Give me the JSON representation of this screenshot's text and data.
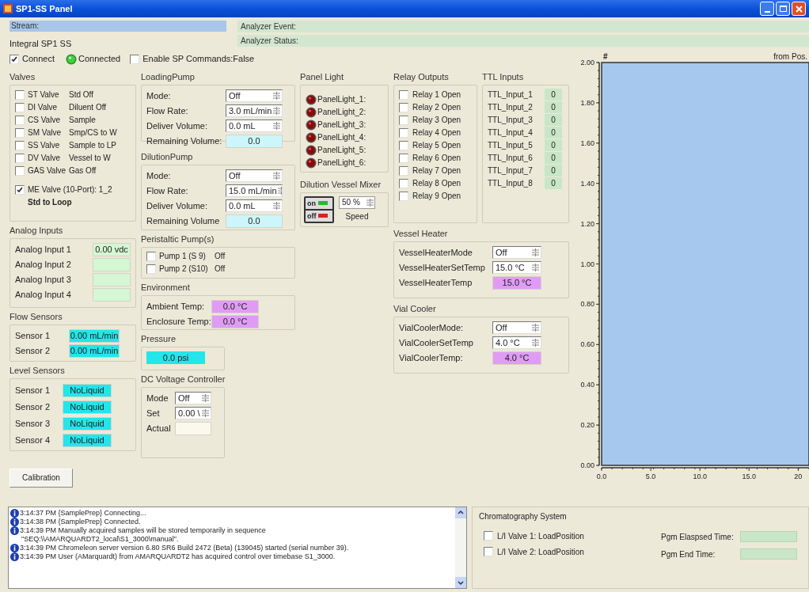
{
  "window": {
    "title": "SP1-SS Panel"
  },
  "header": {
    "stream_label": "Stream:",
    "analyzer_event_label": "Analyzer Event:",
    "analyzer_status_label": "Analyzer Status:",
    "device": "Integral SP1 SS"
  },
  "connection": {
    "connect": {
      "label": "Connect",
      "checked": true
    },
    "status": {
      "label": "Connected",
      "on": true
    },
    "enable_sp": {
      "label": "Enable SP Commands:False",
      "checked": false
    }
  },
  "valves": {
    "title": "Valves",
    "items": [
      {
        "name": "ST Valve",
        "state": "Std Off",
        "checked": false
      },
      {
        "name": "DI Valve",
        "state": "Diluent Off",
        "checked": false
      },
      {
        "name": "CS Valve",
        "state": "Sample",
        "checked": false
      },
      {
        "name": "SM Valve",
        "state": "Smp/CS to W",
        "checked": false
      },
      {
        "name": "SS Valve",
        "state": "Sample to LP",
        "checked": false
      },
      {
        "name": "DV Valve",
        "state": "Vessel to W",
        "checked": false
      },
      {
        "name": "GAS Valve",
        "state": "Gas Off",
        "checked": false
      }
    ],
    "me_valve": {
      "label": "ME Valve (10-Port): 1_2",
      "checked": true,
      "state": "Std to Loop"
    }
  },
  "loading_pump": {
    "title": "LoadingPump",
    "fields": [
      {
        "label": "Mode:",
        "kind": "spin",
        "value": "Off"
      },
      {
        "label": "Flow Rate:",
        "kind": "spin",
        "value": "3.0 mL/min"
      },
      {
        "label": "Deliver Volume:",
        "kind": "spin",
        "value": "0.0 mL"
      },
      {
        "label": "Remaining Volume:",
        "kind": "readout",
        "value": "0.0",
        "color": "#ccf6fb"
      }
    ]
  },
  "dilution_pump": {
    "title": "DilutionPump",
    "fields": [
      {
        "label": "Mode:",
        "kind": "spin",
        "value": "Off"
      },
      {
        "label": "Flow Rate:",
        "kind": "spin",
        "value": "15.0 mL/min"
      },
      {
        "label": "Deliver Volume:",
        "kind": "spin",
        "value": "0.0 mL"
      },
      {
        "label": "Remaining Volume",
        "kind": "readout",
        "value": "0.0",
        "color": "#ccf6fb"
      }
    ]
  },
  "panel_light": {
    "title": "Panel Light",
    "lights": [
      {
        "label": "PanelLight_1:"
      },
      {
        "label": "PanelLight_2:"
      },
      {
        "label": "PanelLight_3:"
      },
      {
        "label": "PanelLight_4:"
      },
      {
        "label": "PanelLight_5:"
      },
      {
        "label": "PanelLight_6:"
      }
    ]
  },
  "mixer": {
    "title": "Dilution Vessel Mixer",
    "on": true,
    "on_label": "on",
    "off_label": "off",
    "speed": "50 %",
    "speed_label": "Speed"
  },
  "relays": {
    "title": "Relay Outputs",
    "items": [
      {
        "label": "Relay 1 Open",
        "checked": false
      },
      {
        "label": "Relay 2 Open",
        "checked": false
      },
      {
        "label": "Relay 3 Open",
        "checked": false
      },
      {
        "label": "Relay 4 Open",
        "checked": false
      },
      {
        "label": "Relay 5 Open",
        "checked": false
      },
      {
        "label": "Relay 6 Open",
        "checked": false
      },
      {
        "label": "Relay 7 Open",
        "checked": false
      },
      {
        "label": "Relay 8 Open",
        "checked": false
      },
      {
        "label": "Relay 9 Open",
        "checked": false
      }
    ]
  },
  "ttl": {
    "title": "TTL Inputs",
    "items": [
      {
        "label": "TTL_Input_1",
        "value": "0"
      },
      {
        "label": "TTL_Input_2",
        "value": "0"
      },
      {
        "label": "TTL_Input_3",
        "value": "0"
      },
      {
        "label": "TTL_Input_4",
        "value": "0"
      },
      {
        "label": "TTL_Input_5",
        "value": "0"
      },
      {
        "label": "TTL_Input_6",
        "value": "0"
      },
      {
        "label": "TTL_Input_7",
        "value": "0"
      },
      {
        "label": "TTL_Input_8",
        "value": "0"
      }
    ]
  },
  "vessel_heater": {
    "title": "Vessel Heater",
    "fields": [
      {
        "label": "VesselHeaterMode",
        "kind": "spin",
        "value": "Off"
      },
      {
        "label": "VesselHeaterSetTemp",
        "kind": "spin",
        "value": "15.0 °C"
      },
      {
        "label": "VesselHeaterTemp",
        "kind": "readout",
        "value": "15.0 °C",
        "color": "#e09cf4"
      }
    ]
  },
  "vial_cooler": {
    "title": "Vial Cooler",
    "fields": [
      {
        "label": "VialCoolerMode:",
        "kind": "spin",
        "value": "Off"
      },
      {
        "label": "VialCoolerSetTemp",
        "kind": "spin",
        "value": "4.0 °C"
      },
      {
        "label": "VialCoolerTemp:",
        "kind": "readout",
        "value": "4.0 °C",
        "color": "#e09cf4"
      }
    ]
  },
  "analog_inputs": {
    "title": "Analog Inputs",
    "fields": [
      {
        "label": "Analog Input 1",
        "kind": "readout",
        "value": "0.00 vdc",
        "color": "#d4f7d4"
      },
      {
        "label": "Analog Input 2",
        "kind": "readout",
        "color": "#d4f7d4"
      },
      {
        "label": "Analog Input 3",
        "kind": "readout",
        "color": "#d4f7d4"
      },
      {
        "label": "Analog Input 4",
        "kind": "readout",
        "color": "#d4f7d4"
      }
    ]
  },
  "flow_sensors": {
    "title": "Flow Sensors",
    "fields": [
      {
        "label": "Sensor 1",
        "kind": "readout",
        "value": "0.00 mL/min",
        "color": "#22e6ea"
      },
      {
        "label": "Sensor 2",
        "kind": "readout",
        "value": "0.00 mL/min",
        "color": "#22e6ea"
      }
    ]
  },
  "level_sensors": {
    "title": "Level Sensors",
    "fields": [
      {
        "label": "Sensor 1",
        "kind": "readout",
        "value": "NoLiquid",
        "color": "#22e6ea"
      },
      {
        "label": "Sensor 2",
        "kind": "readout",
        "value": "NoLiquid",
        "color": "#22e6ea"
      },
      {
        "label": "Sensor 3",
        "kind": "readout",
        "value": "NoLiquid",
        "color": "#22e6ea"
      },
      {
        "label": "Sensor 4",
        "kind": "readout",
        "value": "NoLiquid",
        "color": "#22e6ea"
      }
    ]
  },
  "peristaltic": {
    "title": "Peristaltic Pump(s)",
    "items": [
      {
        "label": "Pump 1 (S 9)",
        "state": "Off",
        "checked": false
      },
      {
        "label": "Pump 2 (S10)",
        "state": "Off",
        "checked": false
      }
    ]
  },
  "environment": {
    "title": "Environment",
    "fields": [
      {
        "label": "Ambient Temp:",
        "kind": "readout",
        "value": "0.0 °C",
        "color": "#e09cf4"
      },
      {
        "label": "Enclosure Temp:",
        "kind": "readout",
        "value": "0.0 °C",
        "color": "#e09cf4"
      }
    ]
  },
  "pressure": {
    "title": "Pressure",
    "value": "0.0 psi"
  },
  "dc_voltage": {
    "title": "DC Voltage Controller",
    "fields": [
      {
        "label": "Mode",
        "kind": "spin",
        "value": "Off"
      },
      {
        "label": "Set",
        "kind": "spin",
        "value": "0.00 \\"
      },
      {
        "label": "Actual",
        "kind": "readout",
        "color": "#fbf8ee"
      }
    ]
  },
  "calibration_button": "Calibration",
  "chart": {
    "header_left": "#",
    "header_right": "from Pos.",
    "chart_data": {
      "type": "line",
      "xlim": [
        0,
        21.1
      ],
      "ylim": [
        0,
        2
      ],
      "xticks": [
        {
          "value": 0,
          "label": "0.0"
        },
        {
          "value": 5,
          "label": "5.0"
        },
        {
          "value": 10,
          "label": "10.0"
        },
        {
          "value": 15,
          "label": "15.0"
        },
        {
          "value": 20,
          "label": "20"
        }
      ],
      "yticks": [
        {
          "value": 0,
          "label": "0.00"
        },
        {
          "value": 0.2,
          "label": "0.20"
        },
        {
          "value": 0.4,
          "label": "0.40"
        },
        {
          "value": 0.6,
          "label": "0.60"
        },
        {
          "value": 0.8,
          "label": "0.80"
        },
        {
          "value": 1,
          "label": "1.00"
        },
        {
          "value": 1.2,
          "label": "1.20"
        },
        {
          "value": 1.4,
          "label": "1.40"
        },
        {
          "value": 1.6,
          "label": "1.60"
        },
        {
          "value": 1.8,
          "label": "1.80"
        },
        {
          "value": 2,
          "label": "2.00"
        }
      ]
    }
  },
  "log": {
    "entries": [
      {
        "text": "3:14:37 PM {SamplePrep} Connecting..."
      },
      {
        "text": "3:14:38 PM {SamplePrep} Connected."
      },
      {
        "text": "3:14:39 PM Manually acquired samples will be stored temporarily in sequence",
        "continued": "\"SEQ:\\\\AMARQUARDT2_local\\S1_3000\\manual\"."
      },
      {
        "text": "3:14:39 PM Chromeleon server version 6.80 SR6 Build 2472 (Beta) (139045) started (serial number 39)."
      },
      {
        "text": "3:14:39 PM User  (AMarquardt) from AMARQUARDT2 has acquired control over timebase S1_3000."
      }
    ]
  },
  "chromatography": {
    "title": "Chromatography System",
    "valves": [
      {
        "label": "L/I Valve 1: LoadPosition",
        "checked": false
      },
      {
        "label": "L/I Valve 2: LoadPosition",
        "checked": false
      }
    ],
    "times": [
      {
        "label": "Pgm Elaspsed Time:"
      },
      {
        "label": "Pgm End Time:"
      }
    ]
  }
}
